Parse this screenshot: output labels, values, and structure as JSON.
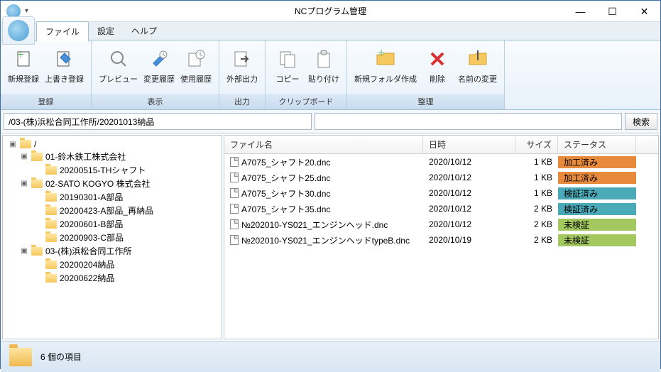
{
  "window": {
    "title": "NCプログラム管理"
  },
  "tabs": {
    "file": "ファイル",
    "settings": "設定",
    "help": "ヘルプ"
  },
  "ribbon": {
    "register": {
      "group": "登録",
      "new": "新規登録",
      "overwrite": "上書き登録"
    },
    "view": {
      "group": "表示",
      "preview": "プレビュー",
      "changelog": "変更履歴",
      "usagelog": "使用履歴"
    },
    "output": {
      "group": "出力",
      "external": "外部出力"
    },
    "clipboard": {
      "group": "クリップボード",
      "copy": "コピー",
      "paste": "貼り付け"
    },
    "organize": {
      "group": "整理",
      "newfolder": "新規フォルダ作成",
      "delete": "削除",
      "rename": "名前の変更"
    }
  },
  "path": "/03-(株)浜松合同工作所/20201013納品",
  "search_btn": "検索",
  "tree": {
    "root": "/",
    "n0": "01-鈴木鉄工株式会社",
    "n0_0": "20200515-THシャフト",
    "n1": "02-SATO KOGYO 株式会社",
    "n1_0": "20190301-A部品",
    "n1_1": "20200423-A部品_再納品",
    "n1_2": "20200601-B部品",
    "n1_3": "20200903-C部品",
    "n2": "03-(株)浜松合同工作所",
    "n2_0": "20200204納品",
    "n2_1": "20200622納品"
  },
  "columns": {
    "name": "ファイル名",
    "date": "日時",
    "size": "サイズ",
    "status": "ステータス"
  },
  "files": {
    "r0": {
      "name": "A7075_シャフト20.dnc",
      "date": "2020/10/12",
      "size": "1 KB",
      "status": "加工済み"
    },
    "r1": {
      "name": "A7075_シャフト25.dnc",
      "date": "2020/10/12",
      "size": "1 KB",
      "status": "加工済み"
    },
    "r2": {
      "name": "A7075_シャフト30.dnc",
      "date": "2020/10/12",
      "size": "1 KB",
      "status": "検証済み"
    },
    "r3": {
      "name": "A7075_シャフト35.dnc",
      "date": "2020/10/12",
      "size": "2 KB",
      "status": "検証済み"
    },
    "r4": {
      "name": "№202010-YS021_エンジンヘッド.dnc",
      "date": "2020/10/12",
      "size": "2 KB",
      "status": "未検証"
    },
    "r5": {
      "name": "№202010-YS021_エンジンヘッドtypeB.dnc",
      "date": "2020/10/19",
      "size": "2 KB",
      "status": "未検証"
    }
  },
  "status": {
    "count": "6 個の項目"
  }
}
